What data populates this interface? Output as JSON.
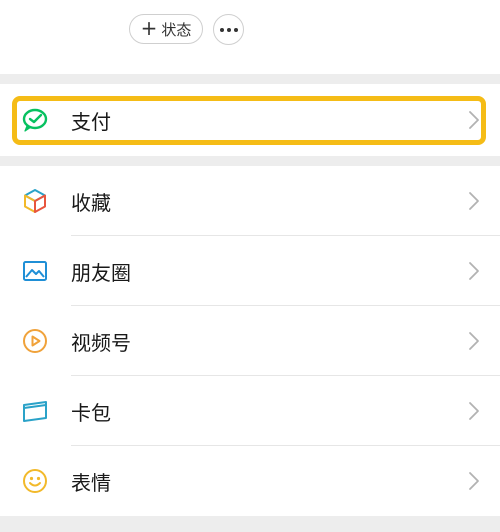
{
  "header": {
    "status_plus": "+",
    "status_label": "状态"
  },
  "pay": {
    "label": "支付",
    "icon": "wechat-pay-icon",
    "highlight_color": "#f5bc16"
  },
  "menu": {
    "items": [
      {
        "label": "收藏",
        "icon": "favorites-cube-icon"
      },
      {
        "label": "朋友圈",
        "icon": "moments-image-icon"
      },
      {
        "label": "视频号",
        "icon": "channels-play-icon"
      },
      {
        "label": "卡包",
        "icon": "card-wallet-icon"
      },
      {
        "label": "表情",
        "icon": "sticker-smiley-icon"
      }
    ]
  },
  "colors": {
    "pay_green": "#07c160",
    "channels_orange": "#f0a23a",
    "moments_blue": "#1f8fd6",
    "cards_teal": "#2aa2c8",
    "stickers_yellow": "#f2b92a"
  }
}
